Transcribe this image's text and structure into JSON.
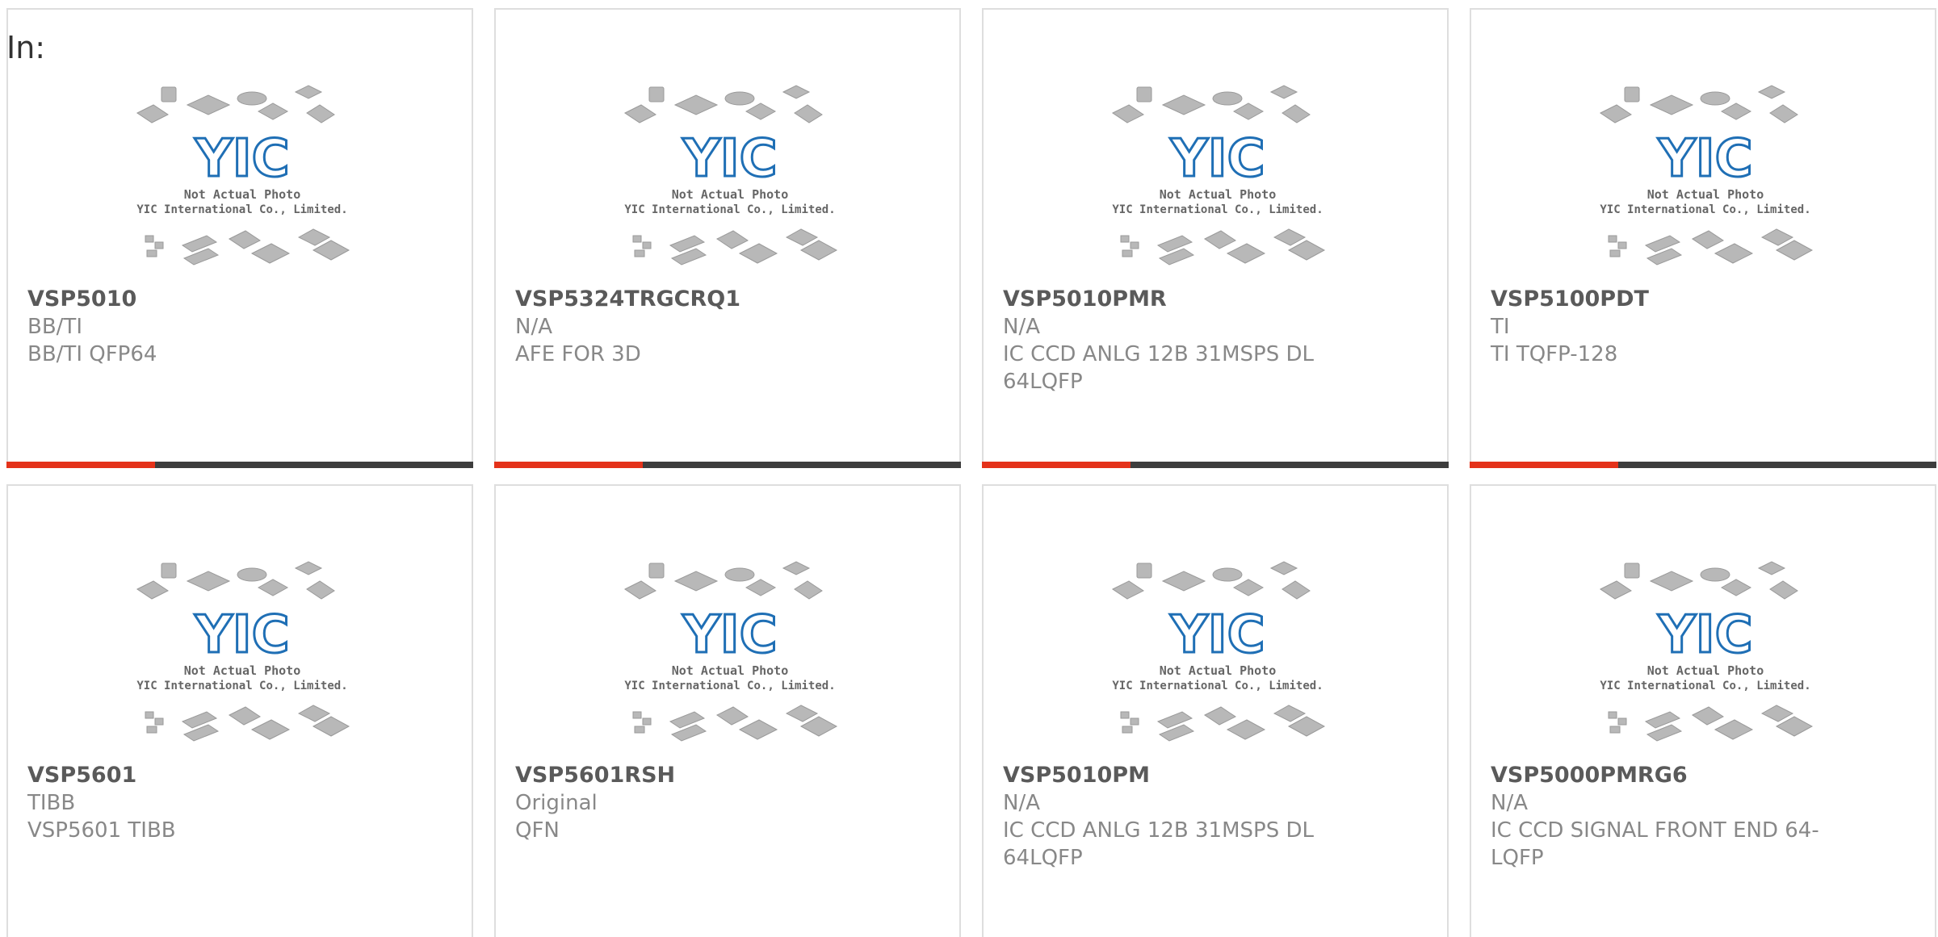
{
  "header": {
    "label": "In:"
  },
  "thumbnail": {
    "caption_line1": "Not Actual Photo",
    "caption_line2": "YIC International Co., Limited.",
    "logo_text": "YIC"
  },
  "colors": {
    "accent": "#e4321a",
    "bar": "#3d3d3d",
    "logo": "#1f6fb5"
  },
  "products": [
    {
      "part": "VSP5010",
      "brand": "BB/TI",
      "desc": "BB/TI QFP64"
    },
    {
      "part": "VSP5324TRGCRQ1",
      "brand": "N/A",
      "desc": "AFE FOR 3D"
    },
    {
      "part": "VSP5010PMR",
      "brand": "N/A",
      "desc": "IC CCD ANLG 12B 31MSPS DL 64LQFP"
    },
    {
      "part": "VSP5100PDT",
      "brand": "TI",
      "desc": "TI TQFP-128"
    },
    {
      "part": "VSP5601",
      "brand": "TIBB",
      "desc": "VSP5601 TIBB"
    },
    {
      "part": "VSP5601RSH",
      "brand": "Original",
      "desc": "QFN"
    },
    {
      "part": "VSP5010PM",
      "brand": "N/A",
      "desc": "IC CCD ANLG 12B 31MSPS DL 64LQFP"
    },
    {
      "part": "VSP5000PMRG6",
      "brand": "N/A",
      "desc": "IC CCD SIGNAL FRONT END 64-LQFP"
    }
  ]
}
